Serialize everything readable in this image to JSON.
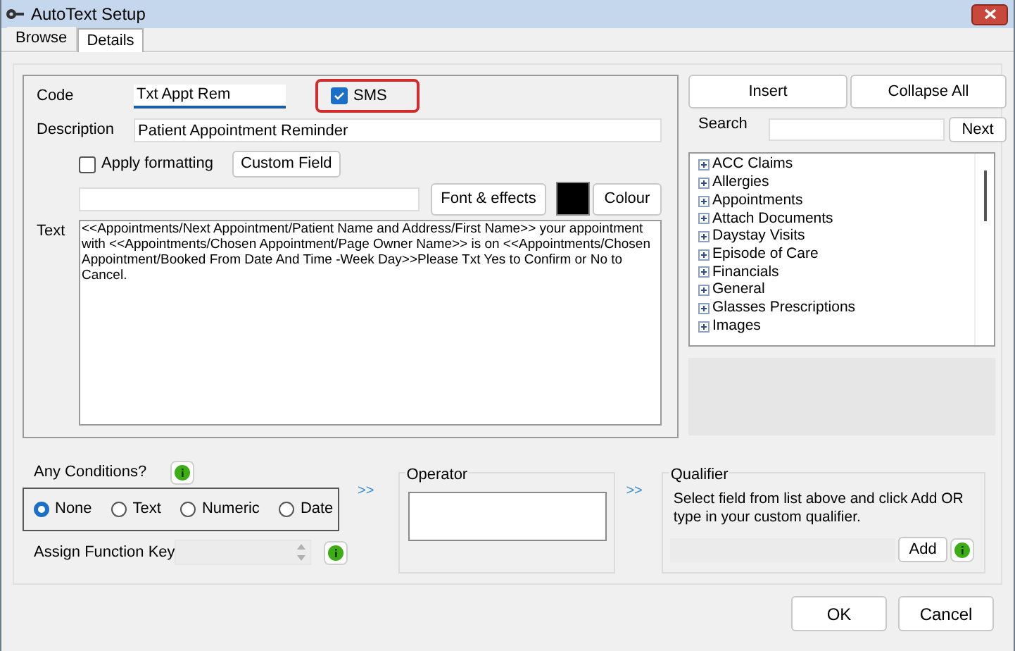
{
  "window": {
    "title": "AutoText Setup"
  },
  "tabs": [
    {
      "label": "Browse",
      "selected": false
    },
    {
      "label": "Details",
      "selected": true
    }
  ],
  "code": {
    "label": "Code",
    "value": "Txt Appt Rem"
  },
  "sms": {
    "label": "SMS",
    "checked": true
  },
  "description": {
    "label": "Description",
    "value": "Patient Appointment Reminder"
  },
  "apply_formatting": {
    "label": "Apply formatting",
    "checked": false
  },
  "custom_field_button": "Custom Field",
  "font_button": "Font & effects",
  "colour": {
    "color": "#000000",
    "button": "Colour"
  },
  "text": {
    "label": "Text",
    "value": "<<Appointments/Next Appointment/Patient Name and Address/First Name>> your appointment with <<Appointments/Chosen Appointment/Page Owner Name>> is on <<Appointments/Chosen Appointment/Booked From Date And Time -Week Day>>Please Txt Yes to Confirm or No to Cancel."
  },
  "insert_button": "Insert",
  "collapse_button": "Collapse All",
  "search": {
    "label": "Search",
    "button": "Next"
  },
  "tree": [
    {
      "label": "ACC Claims",
      "expanded": false
    },
    {
      "label": "Allergies",
      "expanded": false
    },
    {
      "label": "Appointments",
      "expanded": false
    },
    {
      "label": "Attach Documents",
      "expanded": false
    },
    {
      "label": "Daystay Visits",
      "expanded": false
    },
    {
      "label": "Episode of Care",
      "expanded": false
    },
    {
      "label": "Financials",
      "expanded": false
    },
    {
      "label": "General",
      "expanded": false
    },
    {
      "label": "Glasses Prescriptions",
      "expanded": false
    },
    {
      "label": "Images",
      "expanded": false
    }
  ],
  "conditions": {
    "label": "Any Conditions?",
    "options": [
      {
        "label": "None",
        "selected": true
      },
      {
        "label": "Text",
        "selected": false
      },
      {
        "label": "Numeric",
        "selected": false
      },
      {
        "label": "Date",
        "selected": false
      }
    ]
  },
  "function_key": {
    "label": "Assign Function Key",
    "disabled": true
  },
  "arrows": [
    ">>",
    ">>"
  ],
  "operator": {
    "title": "Operator"
  },
  "qualifier": {
    "title": "Qualifier",
    "hint": "Select field from list above and click Add OR type in your custom qualifier.",
    "button": "Add"
  },
  "buttons": [
    "OK",
    "Cancel"
  ]
}
